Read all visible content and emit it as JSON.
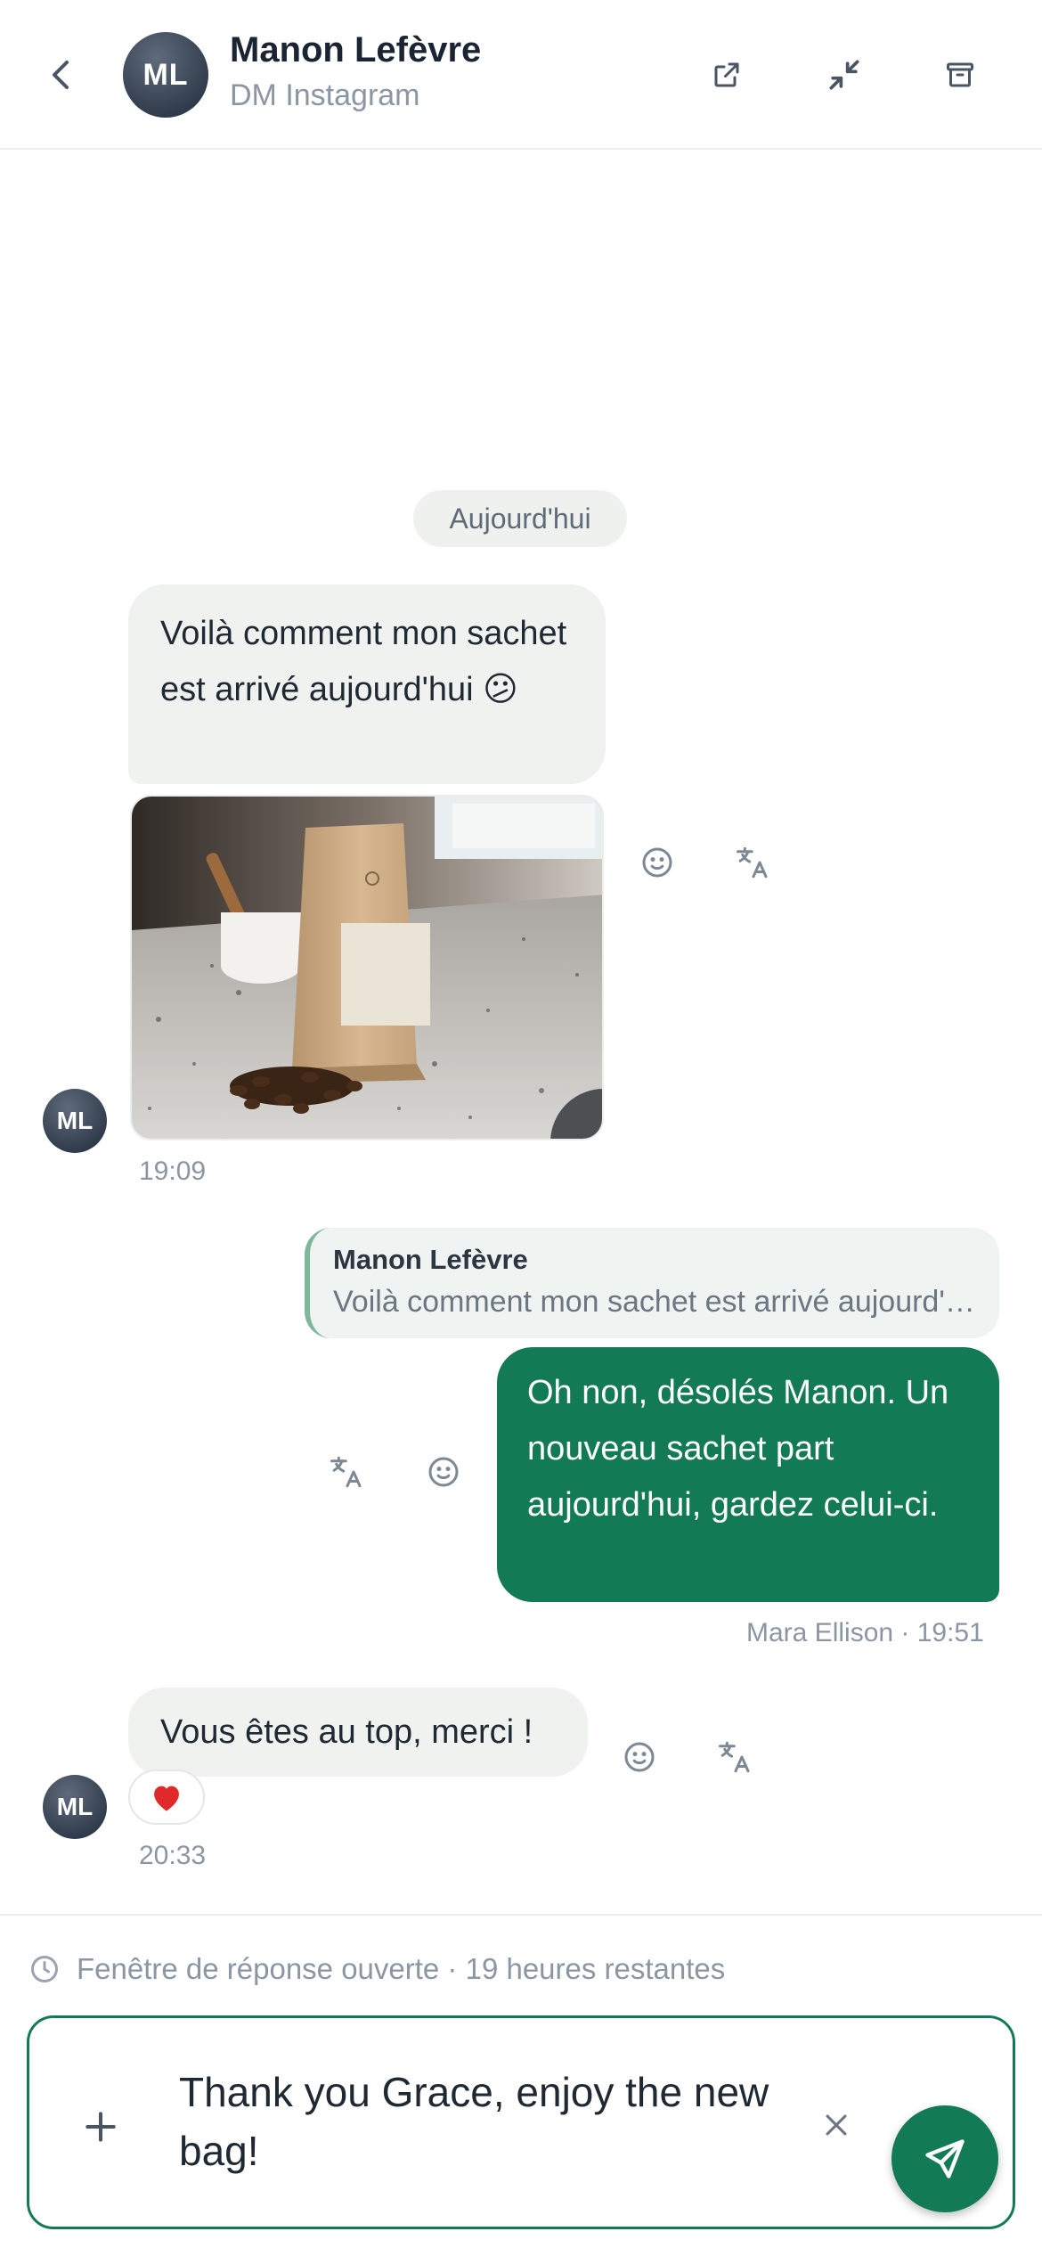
{
  "header": {
    "avatar_initials": "ML",
    "name": "Manon Lefèvre",
    "channel": "DM Instagram",
    "icons": [
      "chevron-left-icon",
      "external-link-icon",
      "minimize-icon",
      "archive-icon"
    ]
  },
  "date_separator": "Aujourd'hui",
  "messages": [
    {
      "direction": "incoming",
      "text": "Voilà comment mon sachet est arrivé aujourd'hui 😕",
      "has_photo": true,
      "avatar_initials": "ML",
      "time": "19:09"
    },
    {
      "direction": "outgoing",
      "reply_to": {
        "name": "Manon Lefèvre",
        "text": "Voilà comment mon sachet est arrivé aujourd'hui 😕"
      },
      "text": "Oh non, désolés Manon. Un nouveau sachet part aujourd'hui, gardez celui-ci.",
      "meta": "Mara Ellison · 19:51"
    },
    {
      "direction": "incoming",
      "text": "Vous êtes au top, merci !",
      "reaction": "❤️",
      "avatar_initials": "ML",
      "time": "20:33"
    }
  ],
  "reply_window": "Fenêtre de réponse ouverte · 19 heures restantes",
  "composer": {
    "value": "Thank you Grace, enjoy the new bag!"
  },
  "colors": {
    "accent": "#137a56",
    "incoming_bubble": "#eff2ee",
    "muted_text": "#8b96a3"
  }
}
